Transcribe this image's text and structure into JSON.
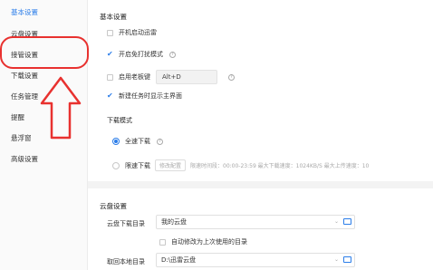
{
  "sidebar": {
    "items": [
      {
        "label": "基本设置",
        "active": true
      },
      {
        "label": "云盘设置",
        "active": false
      },
      {
        "label": "接管设置",
        "active": false
      },
      {
        "label": "下载设置",
        "active": false
      },
      {
        "label": "任务管理",
        "active": false
      },
      {
        "label": "提醒",
        "active": false
      },
      {
        "label": "悬浮窗",
        "active": false
      },
      {
        "label": "高级设置",
        "active": false
      }
    ]
  },
  "basic": {
    "title": "基本设置",
    "startup": {
      "label": "开机启动迅雷",
      "checked": false
    },
    "no_disturb": {
      "label": "开启免打扰模式",
      "checked": true
    },
    "boss_key": {
      "label": "启用老板键",
      "checked": false,
      "hotkey": "Alt+D"
    },
    "show_main": {
      "label": "新建任务时显示主界面",
      "checked": true
    },
    "download_mode": {
      "title": "下载模式",
      "full_speed": {
        "label": "全速下载",
        "selected": true
      },
      "limited": {
        "label": "限速下载",
        "selected": false,
        "config_button": "修改配置",
        "info": "限速时间段：00:00-23:59  最大下载速度：1024KB/S  最大上传速度：10"
      }
    }
  },
  "cloud": {
    "title": "云盘设置",
    "download_dir": {
      "label": "云盘下载目录",
      "value": "我的云盘"
    },
    "auto_modify": {
      "label": "自动修改为上次使用的目录",
      "checked": false
    },
    "local_dir": {
      "label": "取回本地目录",
      "value": "D:\\迅雷云盘"
    }
  },
  "colors": {
    "accent": "#2b7de9",
    "annotation": "#e8312f"
  }
}
